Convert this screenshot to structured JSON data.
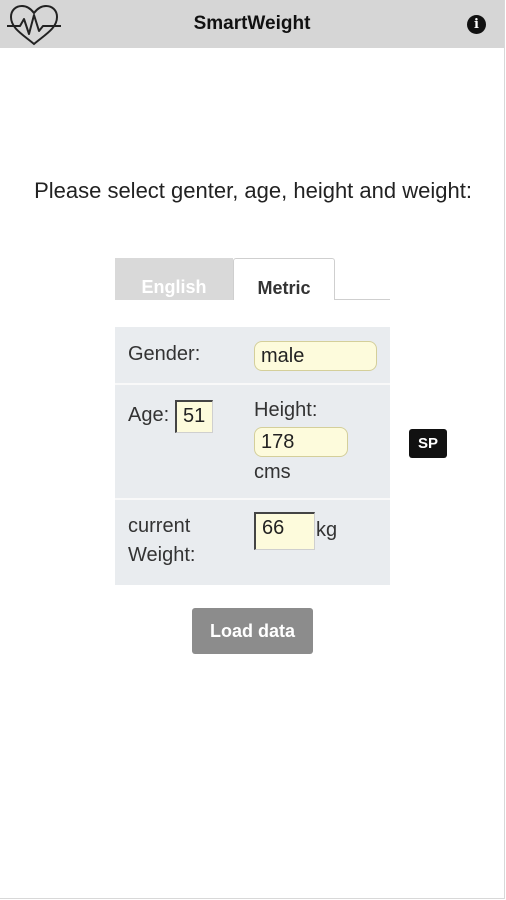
{
  "header": {
    "title": "SmartWeight",
    "info_icon": "i",
    "logo_icon": "heart-pulse-icon"
  },
  "prompt": "Please select genter, age, height and weight:",
  "tabs": [
    {
      "label": "English",
      "active": false
    },
    {
      "label": "Metric",
      "active": true
    }
  ],
  "form": {
    "gender_label": "Gender:",
    "gender_value": "male",
    "age_label": "Age:",
    "age_value": "51",
    "height_label": "Height:",
    "height_value": "178",
    "height_unit": "cms",
    "weight_label_1": "current",
    "weight_label_2": "Weight:",
    "weight_value": "66",
    "weight_unit": "kg"
  },
  "sp_button": "SP",
  "load_button": "Load data",
  "colors": {
    "topbar": "#d6d6d6",
    "panel": "#e9ecef",
    "field": "#fdfbdc",
    "load_button": "#8c8c8c"
  }
}
